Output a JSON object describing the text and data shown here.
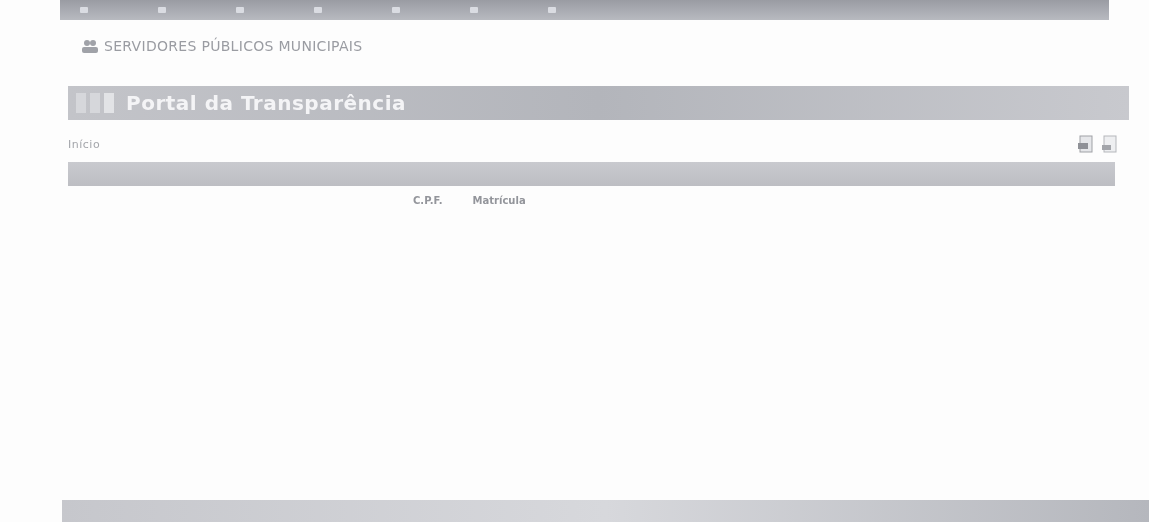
{
  "header": {
    "title": "SERVIDORES PÚBLICOS MUNICIPAIS"
  },
  "banner": {
    "title": "Portal da Transparência"
  },
  "breadcrumb": [
    {
      "label": "Início"
    }
  ],
  "table": {
    "columns": [
      {
        "label": "C.P.F."
      },
      {
        "label": "Matrícula"
      }
    ]
  }
}
